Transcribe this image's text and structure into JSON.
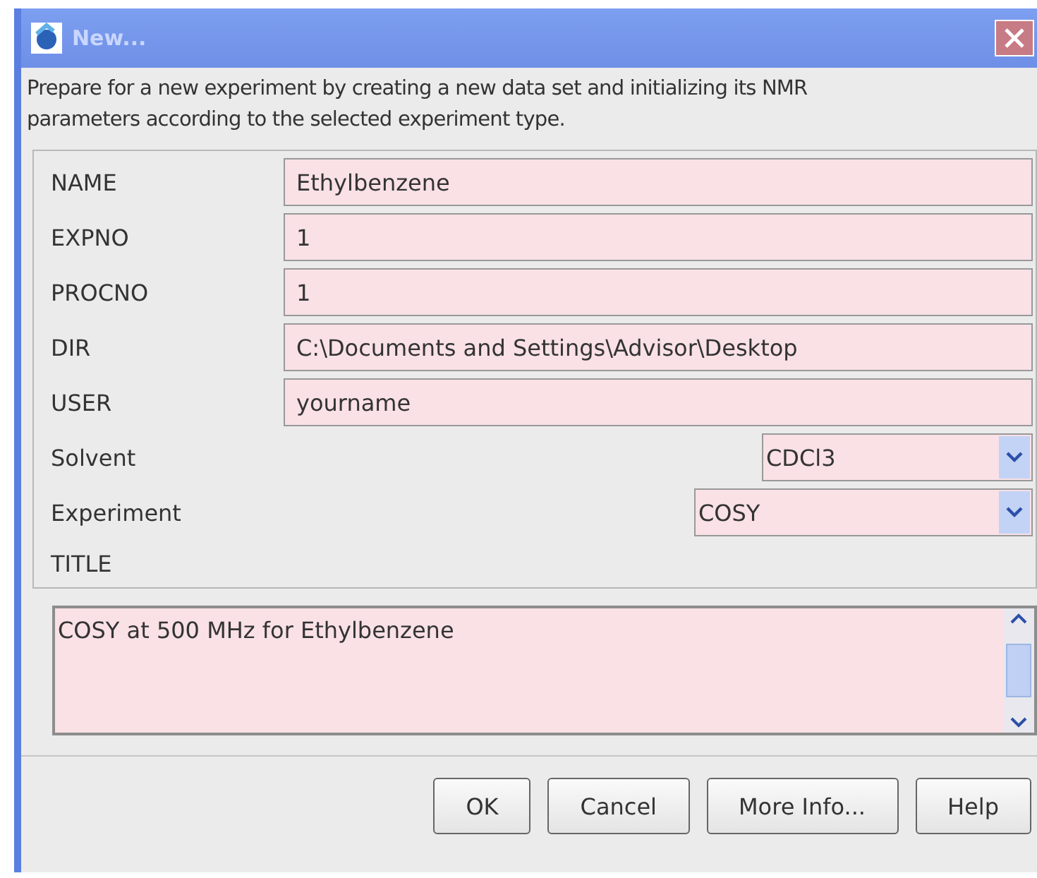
{
  "window": {
    "title": "New..."
  },
  "description": "Prepare for a new experiment by creating a new data set and initializing its NMR parameters according to the selected experiment type.",
  "fields": [
    {
      "kind": "text",
      "label": "NAME",
      "value": "Ethylbenzene"
    },
    {
      "kind": "text",
      "label": "EXPNO",
      "value": "1"
    },
    {
      "kind": "text",
      "label": "PROCNO",
      "value": "1"
    },
    {
      "kind": "text",
      "label": "DIR",
      "value": "C:\\Documents and Settings\\Advisor\\Desktop"
    },
    {
      "kind": "text",
      "label": "USER",
      "value": "yourname"
    },
    {
      "kind": "dropdown",
      "label": "Solvent",
      "value": "CDCl3"
    },
    {
      "kind": "dropdown",
      "label": "Experiment",
      "value": "COSY"
    },
    {
      "kind": "label",
      "label": "TITLE"
    }
  ],
  "title_text": "COSY at 500 MHz for Ethylbenzene",
  "buttons": [
    "OK",
    "Cancel",
    "More Info...",
    "Help"
  ]
}
